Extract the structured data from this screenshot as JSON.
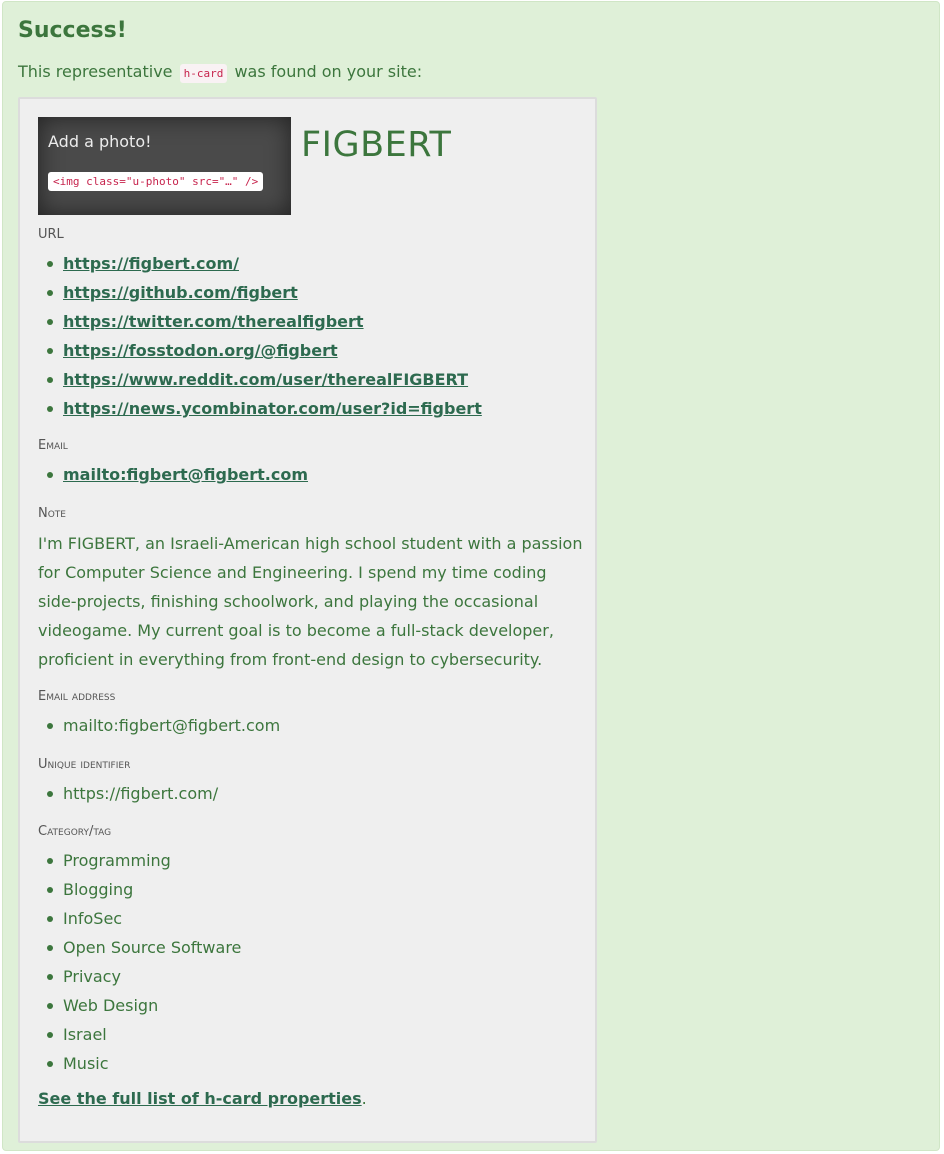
{
  "alert": {
    "title": "Success!",
    "lead_before": "This representative",
    "lead_code": "h-card",
    "lead_after": "was found on your site:"
  },
  "card": {
    "photo_label": "Add a photo!",
    "photo_code": "<img class=\"u-photo\" src=\"…\" />",
    "name": "FIGBERT",
    "url_label": "URL",
    "urls": [
      "https://figbert.com/",
      "https://github.com/figbert",
      "https://twitter.com/therealfigbert",
      "https://fosstodon.org/@figbert",
      "https://www.reddit.com/user/therealFIGBERT",
      "https://news.ycombinator.com/user?id=figbert"
    ],
    "email_label": "Email",
    "emails": [
      "mailto:figbert@figbert.com"
    ],
    "note_label": "Note",
    "note": "I'm FIGBERT, an Israeli-American high school student with a passion for Computer Science and Engineering. I spend my time coding side-projects, finishing schoolwork, and playing the occasional videogame. My current goal is to become a full-stack developer, proficient in everything from front-end design to cybersecurity.",
    "email_address_label": "Email address",
    "email_addresses": [
      "mailto:figbert@figbert.com"
    ],
    "uid_label": "Unique identifier",
    "uids": [
      "https://figbert.com/"
    ],
    "category_label": "Category/tag",
    "categories": [
      "Programming",
      "Blogging",
      "InfoSec",
      "Open Source Software",
      "Privacy",
      "Web Design",
      "Israel",
      "Music"
    ],
    "footer_link": "See the full list of h-card properties",
    "footer_period": "."
  }
}
